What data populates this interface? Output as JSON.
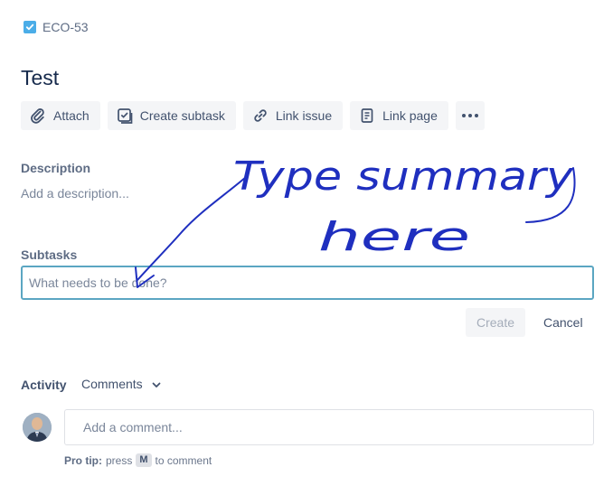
{
  "issue": {
    "key": "ECO-53",
    "title": "Test"
  },
  "toolbar": {
    "attach": "Attach",
    "create_subtask": "Create subtask",
    "link_issue": "Link issue",
    "link_page": "Link page"
  },
  "description": {
    "label": "Description",
    "placeholder": "Add a description..."
  },
  "subtasks": {
    "label": "Subtasks",
    "input_placeholder": "What needs to be done?",
    "input_value": "",
    "create_label": "Create",
    "cancel_label": "Cancel"
  },
  "activity": {
    "label": "Activity",
    "filter_selected": "Comments",
    "comment_placeholder": "Add a comment...",
    "protip_prefix": "Pro tip:",
    "protip_press": "press",
    "protip_key": "M",
    "protip_suffix": "to comment"
  },
  "annotation": {
    "line1": "Type summary",
    "line2": "here",
    "color": "#1f2fbf"
  },
  "colors": {
    "checkbox": "#4bade8",
    "input_focus_border": "#5ba6c2"
  }
}
